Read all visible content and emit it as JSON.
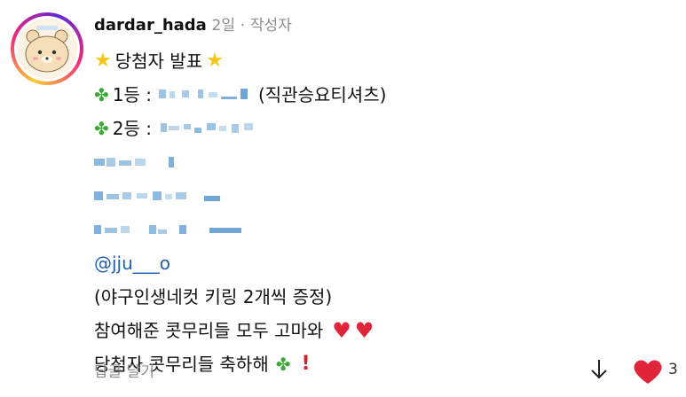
{
  "comment": {
    "username": "dardar_hada",
    "time": "2일",
    "separator": "·",
    "author_badge": "작성자",
    "lines": {
      "announce": "당첨자 발표",
      "first_prize_label": "1등 :",
      "first_prize_item": "(직관승요티셔츠)",
      "second_prize_label": "2등 :",
      "mention": "@jju___o",
      "second_prize_item": "(야구인생네컷 키링 2개씩 증정)",
      "thanks": "참여해준 콧무리들 모두 고마와",
      "congrats": "당첨자 콧무리들 축하해"
    }
  },
  "footer": {
    "reply_label": "답글 달기",
    "like_count": "3"
  },
  "colors": {
    "mention": "#1f5fb0",
    "heart": "#e0243a",
    "star": "#f5c518",
    "clover": "#3ea83a",
    "meta_gray": "#8e8e8e"
  },
  "icons": [
    "star-icon",
    "clover-icon",
    "heart-icon",
    "exclamation-icon",
    "down-arrow-icon",
    "like-heart-icon"
  ]
}
